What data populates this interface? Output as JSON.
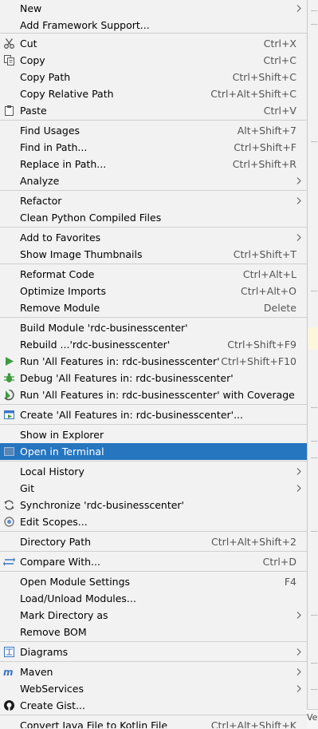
{
  "colors": {
    "selection": "#2675bf",
    "menu_bg": "#f2f2f2",
    "separator": "#cfcfcf",
    "shortcut": "#555555"
  },
  "menu": {
    "items": [
      {
        "label": "New",
        "shortcut": "",
        "submenu": true,
        "icon": ""
      },
      {
        "label": "Add Framework Support...",
        "shortcut": "",
        "submenu": false,
        "icon": ""
      },
      {
        "label": "Cut",
        "shortcut": "Ctrl+X",
        "submenu": false,
        "icon": "scissors-icon"
      },
      {
        "label": "Copy",
        "shortcut": "Ctrl+C",
        "submenu": false,
        "icon": "copy-icon"
      },
      {
        "label": "Copy Path",
        "shortcut": "Ctrl+Shift+C",
        "submenu": false,
        "icon": ""
      },
      {
        "label": "Copy Relative Path",
        "shortcut": "Ctrl+Alt+Shift+C",
        "submenu": false,
        "icon": ""
      },
      {
        "label": "Paste",
        "shortcut": "Ctrl+V",
        "submenu": false,
        "icon": "clipboard-icon"
      },
      {
        "label": "Find Usages",
        "shortcut": "Alt+Shift+7",
        "submenu": false,
        "icon": ""
      },
      {
        "label": "Find in Path...",
        "shortcut": "Ctrl+Shift+F",
        "submenu": false,
        "icon": ""
      },
      {
        "label": "Replace in Path...",
        "shortcut": "Ctrl+Shift+R",
        "submenu": false,
        "icon": ""
      },
      {
        "label": "Analyze",
        "shortcut": "",
        "submenu": true,
        "icon": ""
      },
      {
        "label": "Refactor",
        "shortcut": "",
        "submenu": true,
        "icon": ""
      },
      {
        "label": "Clean Python Compiled Files",
        "shortcut": "",
        "submenu": false,
        "icon": ""
      },
      {
        "label": "Add to Favorites",
        "shortcut": "",
        "submenu": true,
        "icon": ""
      },
      {
        "label": "Show Image Thumbnails",
        "shortcut": "Ctrl+Shift+T",
        "submenu": false,
        "icon": ""
      },
      {
        "label": "Reformat Code",
        "shortcut": "Ctrl+Alt+L",
        "submenu": false,
        "icon": ""
      },
      {
        "label": "Optimize Imports",
        "shortcut": "Ctrl+Alt+O",
        "submenu": false,
        "icon": ""
      },
      {
        "label": "Remove Module",
        "shortcut": "Delete",
        "submenu": false,
        "icon": ""
      },
      {
        "label": "Build Module 'rdc-businesscenter'",
        "shortcut": "",
        "submenu": false,
        "icon": ""
      },
      {
        "label": "Rebuild ...'rdc-businesscenter'",
        "shortcut": "Ctrl+Shift+F9",
        "submenu": false,
        "icon": ""
      },
      {
        "label": "Run 'All Features in: rdc-businesscenter'",
        "shortcut": "Ctrl+Shift+F10",
        "submenu": false,
        "icon": "run-icon"
      },
      {
        "label": "Debug 'All Features in: rdc-businesscenter'",
        "shortcut": "",
        "submenu": false,
        "icon": "debug-icon"
      },
      {
        "label": "Run 'All Features in: rdc-businesscenter' with Coverage",
        "shortcut": "",
        "submenu": false,
        "icon": "coverage-icon"
      },
      {
        "label": "Create 'All Features in: rdc-businesscenter'...",
        "shortcut": "",
        "submenu": false,
        "icon": "create-config-icon"
      },
      {
        "label": "Show in Explorer",
        "shortcut": "",
        "submenu": false,
        "icon": ""
      },
      {
        "label": "Open in Terminal",
        "shortcut": "",
        "submenu": false,
        "icon": "terminal-icon",
        "selected": true
      },
      {
        "label": "Local History",
        "shortcut": "",
        "submenu": true,
        "icon": ""
      },
      {
        "label": "Git",
        "shortcut": "",
        "submenu": true,
        "icon": ""
      },
      {
        "label": "Synchronize 'rdc-businesscenter'",
        "shortcut": "",
        "submenu": false,
        "icon": "sync-icon"
      },
      {
        "label": "Edit Scopes...",
        "shortcut": "",
        "submenu": false,
        "icon": "scope-icon"
      },
      {
        "label": "Directory Path",
        "shortcut": "Ctrl+Alt+Shift+2",
        "submenu": false,
        "icon": ""
      },
      {
        "label": "Compare With...",
        "shortcut": "Ctrl+D",
        "submenu": false,
        "icon": "compare-icon"
      },
      {
        "label": "Open Module Settings",
        "shortcut": "F4",
        "submenu": false,
        "icon": ""
      },
      {
        "label": "Load/Unload Modules...",
        "shortcut": "",
        "submenu": false,
        "icon": ""
      },
      {
        "label": "Mark Directory as",
        "shortcut": "",
        "submenu": true,
        "icon": ""
      },
      {
        "label": "Remove BOM",
        "shortcut": "",
        "submenu": false,
        "icon": ""
      },
      {
        "label": "Diagrams",
        "shortcut": "",
        "submenu": true,
        "icon": "diagram-icon"
      },
      {
        "label": "Maven",
        "shortcut": "",
        "submenu": true,
        "icon": "maven-icon"
      },
      {
        "label": "WebServices",
        "shortcut": "",
        "submenu": true,
        "icon": ""
      },
      {
        "label": "Create Gist...",
        "shortcut": "",
        "submenu": false,
        "icon": "github-icon"
      },
      {
        "label": "Convert Java File to Kotlin File",
        "shortcut": "Ctrl+Alt+Shift+K",
        "submenu": false,
        "icon": ""
      }
    ]
  },
  "edge_tail": "Vers"
}
